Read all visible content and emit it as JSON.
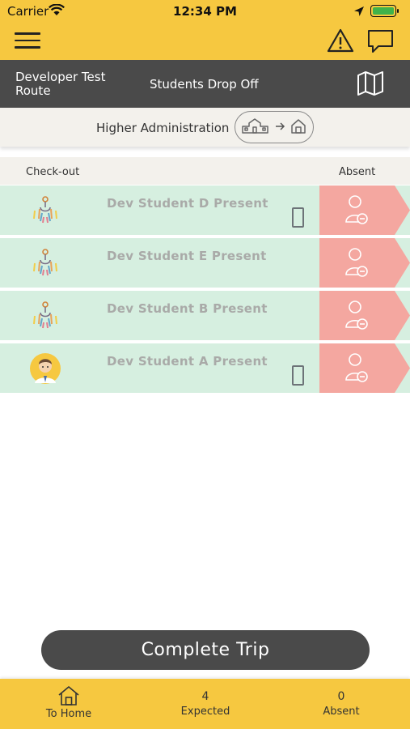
{
  "status_bar": {
    "carrier": "Carrier",
    "time": "12:34 PM"
  },
  "route": {
    "name": "Developer Test Route",
    "trip_type": "Students Drop Off"
  },
  "destination": {
    "label": "Higher Administration"
  },
  "columns": {
    "checkout": "Check-out",
    "absent": "Absent"
  },
  "students": [
    {
      "name": "Dev Student D Present",
      "avatar": "generic-avatar-icon",
      "has_phone": true
    },
    {
      "name": "Dev Student E Present",
      "avatar": "generic-avatar-icon",
      "has_phone": false
    },
    {
      "name": "Dev Student B Present",
      "avatar": "generic-avatar-icon",
      "has_phone": false
    },
    {
      "name": "Dev Student A Present",
      "avatar": "boy-avatar-icon",
      "has_phone": true
    }
  ],
  "complete_button": "Complete Trip",
  "tab_bar": {
    "home_label": "To Home",
    "expected_count": "4",
    "expected_label": "Expected",
    "absent_count": "0",
    "absent_label": "Absent"
  },
  "colors": {
    "brand_yellow": "#f6c840",
    "dark_gray": "#4a4a4a",
    "present_green": "#d6efe0",
    "absent_red": "#f4a7a0"
  }
}
